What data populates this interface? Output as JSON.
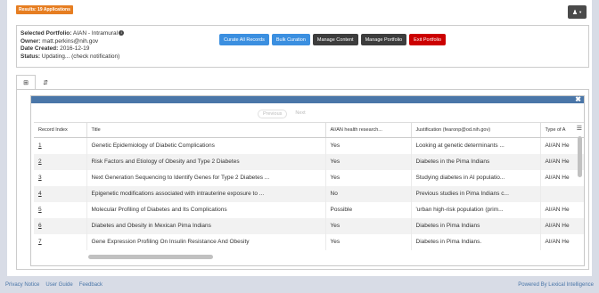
{
  "header": {
    "results_badge": "Results: 19 Applications",
    "user_menu_icon": "user-icon"
  },
  "portfolio": {
    "selected_label": "Selected Portfolio:",
    "selected_value": "AIAN - Intramural",
    "owner_label": "Owner:",
    "owner_value": "matt.perkins@nih.gov",
    "date_label": "Date Created:",
    "date_value": "2016-12-19",
    "status_label": "Status:",
    "status_value": "Updating... (check notification)"
  },
  "buttons": {
    "curate_all": "Curate All Records",
    "bulk_curation": "Bulk Curation",
    "manage_content": "Manage Content",
    "manage_portfolio": "Manage Portfolio",
    "exit_portfolio": "Exit Portfolio"
  },
  "colors": {
    "badge": "#e67e22",
    "primary": "#3b8fe0",
    "dark": "#3d3d3d",
    "danger": "#cc0000",
    "grid_header": "#4a76a8"
  },
  "tabs": [
    {
      "icon": "grid-icon",
      "glyph": "⊞"
    },
    {
      "icon": "sort-icon",
      "glyph": "⇵"
    }
  ],
  "pager": {
    "previous": "Previous",
    "next": "Next"
  },
  "table": {
    "columns": [
      "Record Index",
      "Title",
      "AI/AN health research...",
      "Justification (fearonp@od.nih.gov)",
      "Type of A"
    ],
    "rows": [
      [
        "1",
        "Genetic Epidemiology of Diabetic Complications",
        "Yes",
        "Looking at genetic determinants ...",
        "AI/AN He"
      ],
      [
        "2",
        "Risk Factors and Etiology of Obesity and Type 2 Diabetes",
        "Yes",
        "Diabetes in the Pima Indians",
        "AI/AN He"
      ],
      [
        "3",
        "Next Generation Sequencing to Identify Genes for Type 2 Diabetes ...",
        "Yes",
        "Studying diabetes in AI populatio...",
        "AI/AN He"
      ],
      [
        "4",
        "Epigenetic modifications associated with intrauterine exposure to ...",
        "No",
        "Previous studies in Pima Indians c...",
        ""
      ],
      [
        "5",
        "Molecular Profiling of Diabetes and Its Complications",
        "Possible",
        "'urban high-risk population (prim...",
        "AI/AN He"
      ],
      [
        "6",
        "Diabetes and Obesity in Mexican Pima Indians",
        "Yes",
        "Diabetes in Pima Indians",
        "AI/AN He"
      ],
      [
        "7",
        "Gene Expression Profiling On Insulin Resistance And Obesity",
        "Yes",
        "Diabetes in Pima Indians.",
        "AI/AN He"
      ]
    ]
  },
  "footer": {
    "privacy": "Privacy Notice",
    "guide": "User Guide",
    "feedback": "Feedback",
    "powered": "Powered By Lexical Intelligence"
  }
}
